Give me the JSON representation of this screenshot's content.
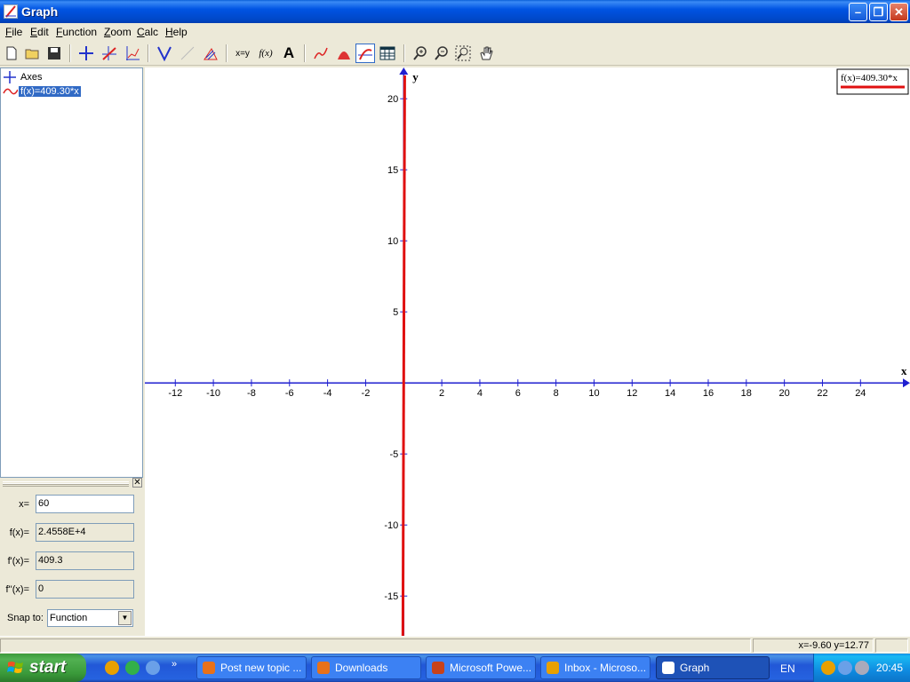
{
  "window": {
    "title": "Graph"
  },
  "menu": [
    {
      "label": "File",
      "u": "F",
      "rest": "ile"
    },
    {
      "label": "Edit",
      "u": "E",
      "rest": "dit"
    },
    {
      "label": "Function",
      "u": "F",
      "rest": "unction"
    },
    {
      "label": "Zoom",
      "u": "Z",
      "rest": "oom"
    },
    {
      "label": "Calc",
      "u": "C",
      "rest": "alc"
    },
    {
      "label": "Help",
      "u": "H",
      "rest": "elp"
    }
  ],
  "toolbar_icons": [
    "new-file-icon",
    "open-folder-icon",
    "save-icon",
    "axes-icon",
    "insert-function-icon",
    "tangent-icon",
    "shading-icon",
    "relation-icon",
    "point-series-icon",
    "text-x-y-icon",
    "f-of-x-icon",
    "text-A-icon",
    "trendline-icon",
    "area-icon",
    "trace-icon",
    "table-icon",
    "zoom-in-icon",
    "zoom-out-icon",
    "zoom-window-icon",
    "pan-hand-icon"
  ],
  "toolbar_text": {
    "xy": "x=y",
    "fx": "f(x)",
    "A": "A"
  },
  "tree": {
    "axes_label": "Axes",
    "function_label": "f(x)=409.30*x"
  },
  "evaluate": {
    "x_label": "x=",
    "x_value": "60",
    "fx_label": "f(x)=",
    "fx_value": "2.4558E+4",
    "dfx_label": "f'(x)=",
    "dfx_value": "409.3",
    "ddfx_label": "f''(x)=",
    "ddfx_value": "0",
    "snap_label": "Snap to:",
    "snap_value": "Function"
  },
  "chart_data": {
    "type": "line",
    "function": "f(x)=409.30*x",
    "slope": 409.3,
    "xlim": [
      -13.6,
      26.6
    ],
    "ylim": [
      -17.8,
      22.2
    ],
    "x_ticks": [
      -12,
      -10,
      -8,
      -6,
      -4,
      -2,
      2,
      4,
      6,
      8,
      10,
      12,
      14,
      16,
      18,
      20,
      22,
      24
    ],
    "y_ticks": [
      -15,
      -10,
      -5,
      5,
      10,
      15,
      20
    ],
    "xlabel": "x",
    "ylabel": "y",
    "legend": "f(x)=409.30*x",
    "legend_position": "top-right",
    "line_color": "#e01010",
    "axis_color": "#1f1fd0",
    "grid": false
  },
  "status": {
    "coords": "x=-9.60  y=12.77"
  },
  "taskbar": {
    "start_label": "start",
    "tasks": [
      {
        "label": "Post new topic ...",
        "icon": "firefox-icon"
      },
      {
        "label": "Downloads",
        "icon": "firefox-icon"
      },
      {
        "label": "Microsoft Powe...",
        "icon": "powerpoint-icon"
      },
      {
        "label": "Inbox - Microso...",
        "icon": "outlook-icon"
      },
      {
        "label": "Graph",
        "icon": "graph-app-icon"
      }
    ],
    "language": "EN",
    "clock": "20:45"
  }
}
